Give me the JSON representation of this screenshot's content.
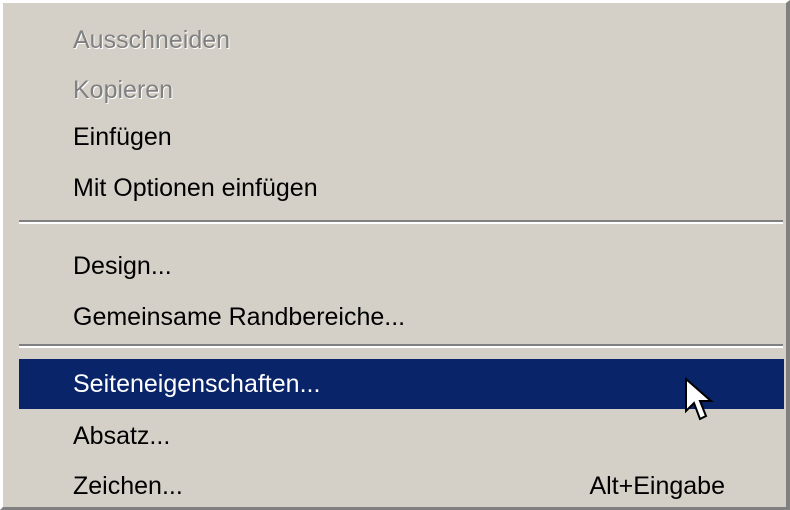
{
  "menu": {
    "items": [
      {
        "label": "Ausschneiden",
        "shortcut": "",
        "state": "disabled"
      },
      {
        "label": "Kopieren",
        "shortcut": "",
        "state": "disabled"
      },
      {
        "label": "Einfügen",
        "shortcut": "",
        "state": "enabled"
      },
      {
        "label": "Mit Optionen einfügen",
        "shortcut": "",
        "state": "enabled"
      },
      {
        "label": "Design...",
        "shortcut": "",
        "state": "enabled"
      },
      {
        "label": "Gemeinsame Randbereiche...",
        "shortcut": "",
        "state": "enabled"
      },
      {
        "label": "Seiteneigenschaften...",
        "shortcut": "",
        "state": "selected"
      },
      {
        "label": "Absatz...",
        "shortcut": "",
        "state": "enabled"
      },
      {
        "label": "Zeichen...",
        "shortcut": "Alt+Eingabe",
        "state": "enabled"
      }
    ]
  },
  "colors": {
    "menu_background": "#d4d0c8",
    "highlight_background": "#0a246a",
    "highlight_text": "#ffffff",
    "disabled_text": "#808080"
  },
  "cursor": {
    "icon": "arrow-pointer-icon"
  }
}
